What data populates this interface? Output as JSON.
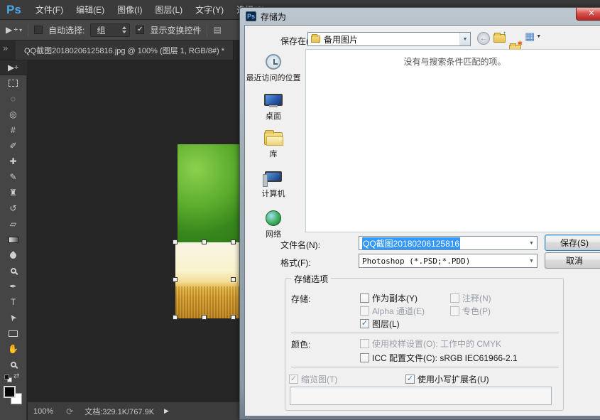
{
  "ps": {
    "logo": "Ps",
    "menus": [
      "文件(F)",
      "编辑(E)",
      "图像(I)",
      "图层(L)",
      "文字(Y)",
      "选择(S)"
    ],
    "options": {
      "auto_select_label": "自动选择:",
      "group_value": "组",
      "show_transform_label": "显示变换控件"
    },
    "doc_tab": "QQ截图20180206125816.jpg @ 100% (图层 1, RGB/8#) *",
    "statusbar": {
      "zoom": "100%",
      "doc_info": "文档:329.1K/767.9K"
    }
  },
  "dialog": {
    "title": "存储为",
    "save_in_label": "保存在(I):",
    "save_in_value": "备用图片",
    "empty_message": "没有与搜索条件匹配的项。",
    "places": [
      "最近访问的位置",
      "桌面",
      "库",
      "计算机",
      "网络"
    ],
    "filename_label": "文件名(N):",
    "filename_value": "QQ截图20180206125816",
    "format_label": "格式(F):",
    "format_value": "Photoshop (*.PSD;*.PDD)",
    "save_button": "保存(S)",
    "cancel_button": "取消",
    "options_group": {
      "title": "存储选项",
      "save_label": "存储:",
      "as_copy": "作为副本(Y)",
      "annotations": "注释(N)",
      "alpha": "Alpha 通道(E)",
      "spot": "专色(P)",
      "layers": "图层(L)",
      "color_label": "颜色:",
      "proof": "使用校样设置(O): 工作中的 CMYK",
      "icc": "ICC 配置文件(C): sRGB IEC61966-2.1",
      "thumbnail": "缩览图(T)",
      "lowercase": "使用小写扩展名(U)"
    }
  },
  "icons": {
    "collapse": "»",
    "move": "▶",
    "move_plus": "✛",
    "caret_down": "▾",
    "lasso": "◌",
    "quick_select": "◎",
    "crop": "#",
    "eyedropper": "✐",
    "healing": "✚",
    "brush": "✎",
    "stamp": "♜",
    "history": "↺",
    "eraser": "▱",
    "pen": "✒",
    "type": "T",
    "path_select": "➤",
    "hand": "✋",
    "swap": "⇄",
    "align": "▤",
    "check": "✓",
    "close": "✕",
    "back": "←",
    "up": "↑",
    "star": "✱",
    "grid": "▦",
    "dropdown": "▼",
    "status_refresh": "⟳",
    "status_arrow": "▶"
  },
  "colors": {
    "accent_selection": "#3399ff",
    "logo_blue": "#4aa9e8",
    "close_red": "#b02a25",
    "dialog_bg": "#f0f0f1",
    "pasteboard": "#262626"
  }
}
